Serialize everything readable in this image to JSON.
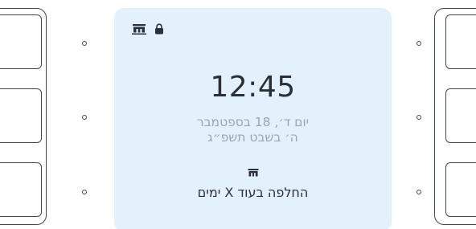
{
  "screen": {
    "status_icons": [
      "gate-icon",
      "lock-icon"
    ],
    "time": "12:45",
    "date_gregorian": "יום ד׳, 18 בספטמבר",
    "date_hebrew": "ה׳ בשבט תשפ״ג",
    "notice_icon": "gate-icon",
    "notice_text": "החלפה בעוד X ימים"
  },
  "colors": {
    "screen_background": "#e2f1fb",
    "primary_text": "#2b3038",
    "secondary_text": "#9aa6b1",
    "frame_stroke": "#3f4750"
  }
}
